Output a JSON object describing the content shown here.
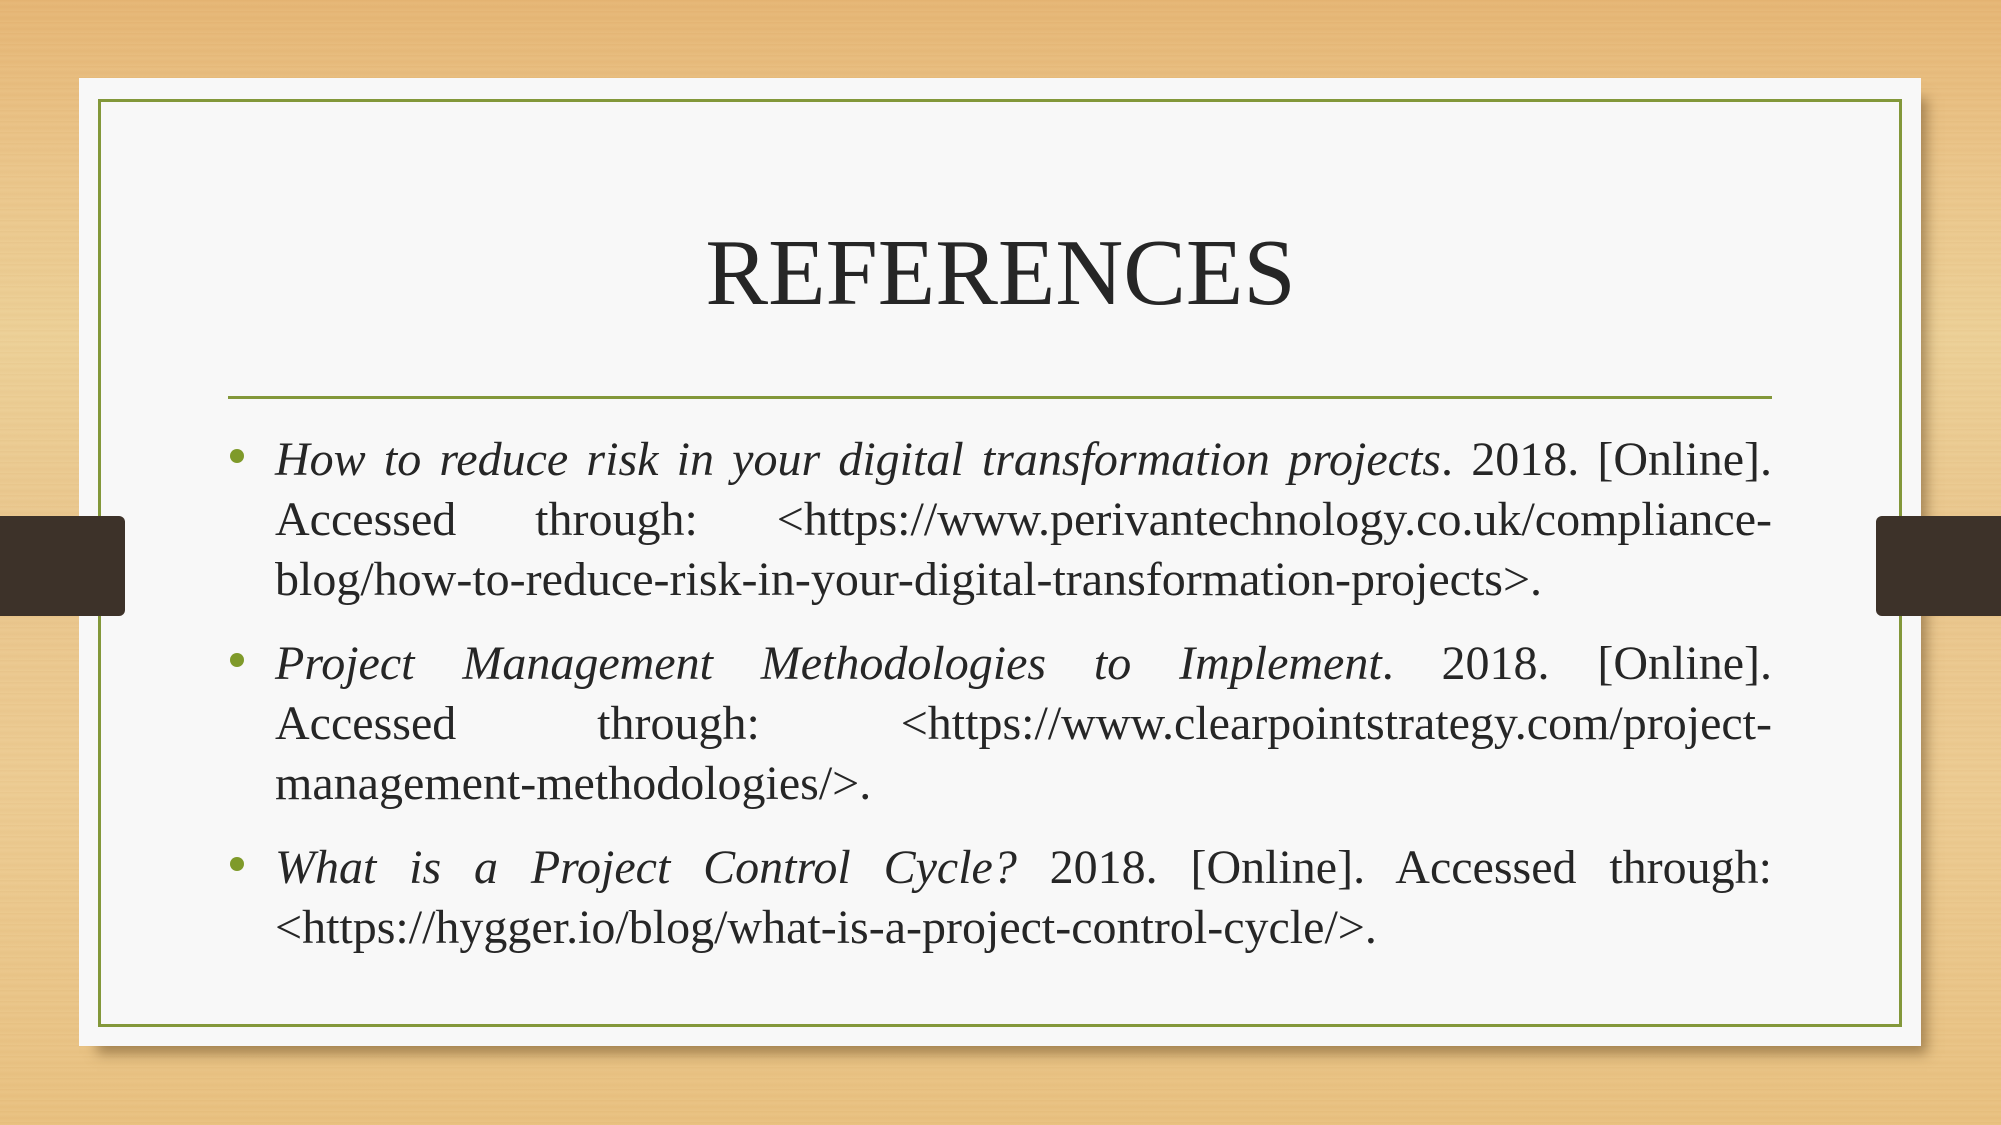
{
  "slide": {
    "title": "REFERENCES",
    "colors": {
      "accent": "#83983a",
      "bullet": "#7f9a2a",
      "text": "#262626",
      "card": "#f8f8f8",
      "tab": "#3d3229",
      "background": "#e9c58a"
    },
    "references": [
      {
        "lines": [
          {
            "italic": "How to reduce risk in your digital transformation projects",
            "normal": ". 2018. [Online]."
          },
          {
            "italic": "",
            "normal": "Accessed through: <https://www.perivantechnology.co.uk/compliance-"
          },
          {
            "italic": "",
            "normal": "blog/how-to-reduce-risk-in-your-digital-transformation-projects>."
          }
        ]
      },
      {
        "lines": [
          {
            "italic": "Project Management Methodologies to Implement",
            "normal": ". 2018. [Online]."
          },
          {
            "italic": "",
            "normal": "Accessed through: <https://www.clearpointstrategy.com/project-"
          },
          {
            "italic": "",
            "normal": "management-methodologies/>."
          }
        ]
      },
      {
        "lines": [
          {
            "italic": "What is a Project Control Cycle?",
            "normal": " 2018. [Online]. Accessed through:"
          },
          {
            "italic": "",
            "normal": "<https://hygger.io/blog/what-is-a-project-control-cycle/>."
          }
        ]
      }
    ]
  }
}
